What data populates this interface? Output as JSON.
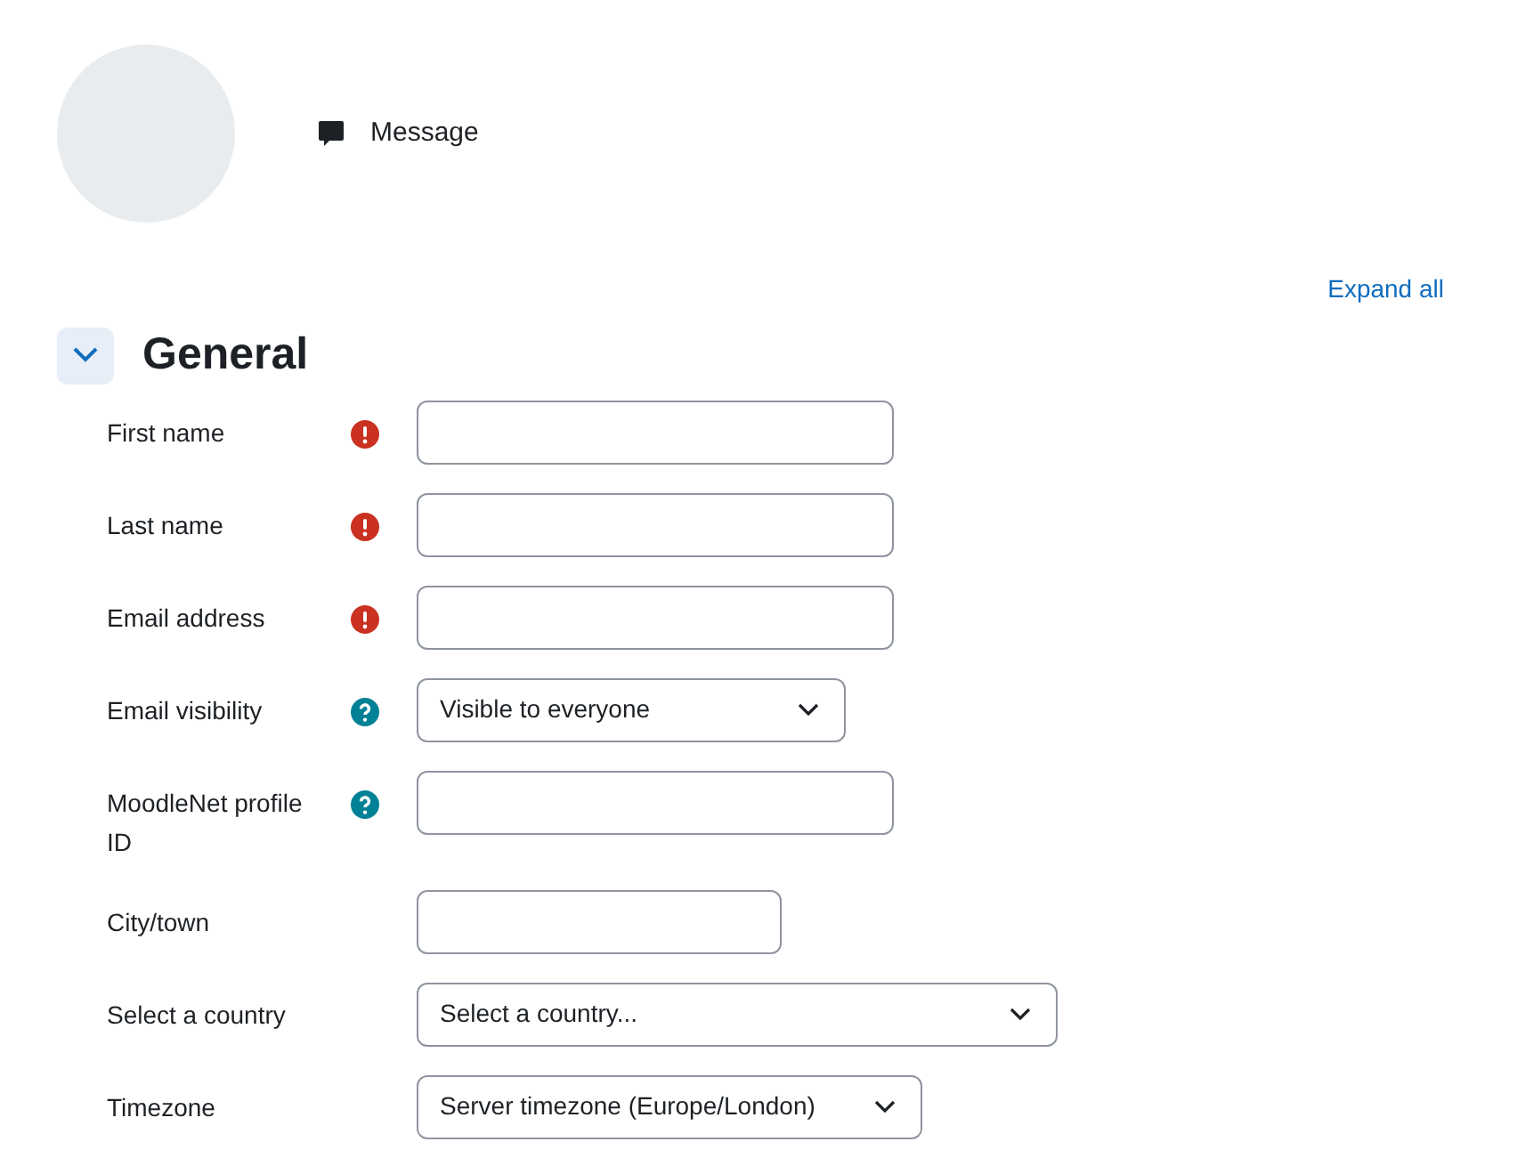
{
  "profile": {
    "message_link": "Message"
  },
  "expand_all": "Expand all",
  "section": {
    "title": "General",
    "expanded": true
  },
  "fields": [
    {
      "label": "First name",
      "kind": "text",
      "required": true,
      "help": false
    },
    {
      "label": "Last name",
      "kind": "text",
      "required": true,
      "help": false
    },
    {
      "label": "Email address",
      "kind": "text",
      "required": true,
      "help": false
    },
    {
      "label": "Email visibility",
      "kind": "select",
      "required": false,
      "help": true,
      "value": "Visible to everyone"
    },
    {
      "label": "MoodleNet profile ID",
      "kind": "text",
      "required": false,
      "help": true
    },
    {
      "label": "City/town",
      "kind": "text",
      "required": false,
      "help": false
    },
    {
      "label": "Select a country",
      "kind": "select",
      "required": false,
      "help": false,
      "value": "Select a country..."
    },
    {
      "label": "Timezone",
      "kind": "select",
      "required": false,
      "help": false,
      "value": "Server timezone (Europe/London)"
    }
  ]
}
